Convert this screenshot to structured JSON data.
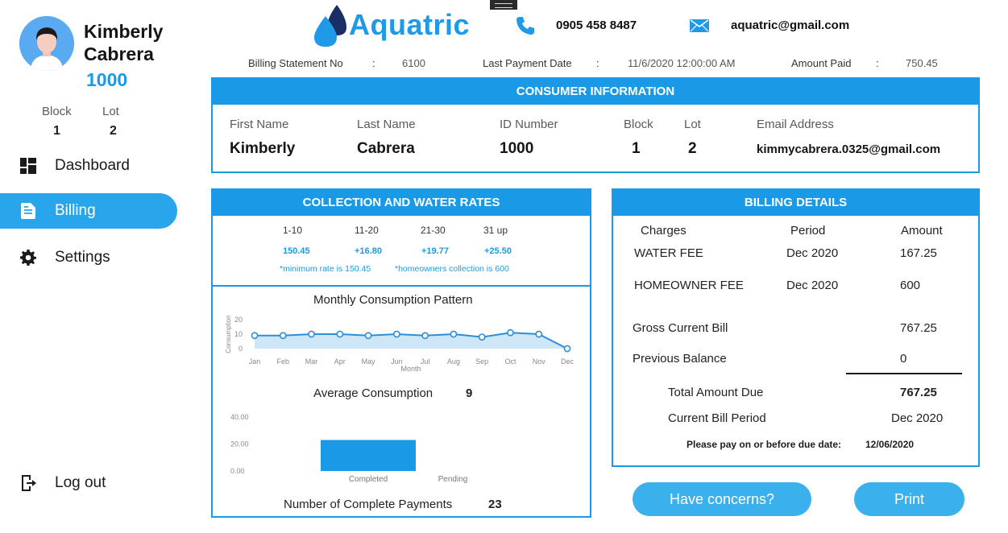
{
  "user": {
    "first_name": "Kimberly",
    "last_name": "Cabrera",
    "id": "1000",
    "block_label": "Block",
    "block": "1",
    "lot_label": "Lot",
    "lot": "2"
  },
  "nav": [
    {
      "label": "Dashboard",
      "icon": "dashboard-icon"
    },
    {
      "label": "Billing",
      "icon": "billing-icon",
      "active": true
    },
    {
      "label": "Settings",
      "icon": "gear-icon"
    }
  ],
  "logout_label": "Log out",
  "header": {
    "app_name": "Aquatric",
    "phone": "0905 458 8487",
    "email": "aquatric@gmail.com"
  },
  "statement": {
    "no_label": "Billing Statement No",
    "no": "6100",
    "last_payment_label": "Last Payment Date",
    "last_payment": "11/6/2020 12:00:00 AM",
    "amount_paid_label": "Amount Paid",
    "amount_paid": "750.45",
    "sep": ":"
  },
  "consumer": {
    "title": "CONSUMER INFORMATION",
    "labels": {
      "first": "First Name",
      "last": "Last Name",
      "id": "ID Number",
      "block": "Block",
      "lot": "Lot",
      "email": "Email Address"
    },
    "values": {
      "first": "Kimberly",
      "last": "Cabrera",
      "id": "1000",
      "block": "1",
      "lot": "2",
      "email": "kimmycabrera.0325@gmail.com"
    }
  },
  "rates": {
    "title": "COLLECTION AND WATER RATES",
    "ranges": [
      "1-10",
      "11-20",
      "21-30",
      "31 up"
    ],
    "values": [
      "150.45",
      "+16.80",
      "+19.77",
      "+25.50"
    ],
    "note_min": "*minimum rate is 150.45",
    "note_home": "*homeowners collection is 600"
  },
  "charts": {
    "monthly_title": "Monthly Consumption Pattern",
    "average_label": "Average Consumption",
    "average_value": "9",
    "payments_label": "Number of Complete Payments",
    "payments_value": "23"
  },
  "chart_data": [
    {
      "type": "line",
      "title": "Monthly Consumption Pattern",
      "xlabel": "Month",
      "ylabel": "Consumption",
      "categories": [
        "Jan",
        "Feb",
        "Mar",
        "Apr",
        "May",
        "Jun",
        "Jul",
        "Aug",
        "Sep",
        "Oct",
        "Nov",
        "Dec"
      ],
      "values": [
        9,
        9,
        10,
        10,
        9,
        10,
        9,
        10,
        8,
        11,
        10,
        0
      ],
      "yticks": [
        0,
        10,
        20
      ],
      "ylim": [
        0,
        20
      ],
      "area_fill": true,
      "color": "#2b8fd8"
    },
    {
      "type": "bar",
      "categories": [
        "Completed",
        "Pending"
      ],
      "values": [
        23,
        0
      ],
      "yticks": [
        "0.00",
        "20.00",
        "40.00"
      ],
      "ylim": [
        0,
        40
      ],
      "color": "#1a9ae6"
    }
  ],
  "billing": {
    "title": "BILLING DETAILS",
    "headers": {
      "charges": "Charges",
      "period": "Period",
      "amount": "Amount"
    },
    "rows": [
      {
        "charge": "WATER FEE",
        "period": "Dec 2020",
        "amount": "167.25"
      },
      {
        "charge": "HOMEOWNER FEE",
        "period": "Dec 2020",
        "amount": "600"
      }
    ],
    "gross_label": "Gross Current Bill",
    "gross": "767.25",
    "prev_label": "Previous Balance",
    "prev": "0",
    "total_label": "Total Amount Due",
    "total": "767.25",
    "period_label": "Current Bill Period",
    "period": "Dec 2020",
    "due_label": "Please pay on or before due date:",
    "due": "12/06/2020"
  },
  "buttons": {
    "concerns": "Have concerns?",
    "print": "Print"
  },
  "colors": {
    "accent": "#1a9ae6",
    "button": "#3ab0ec"
  }
}
